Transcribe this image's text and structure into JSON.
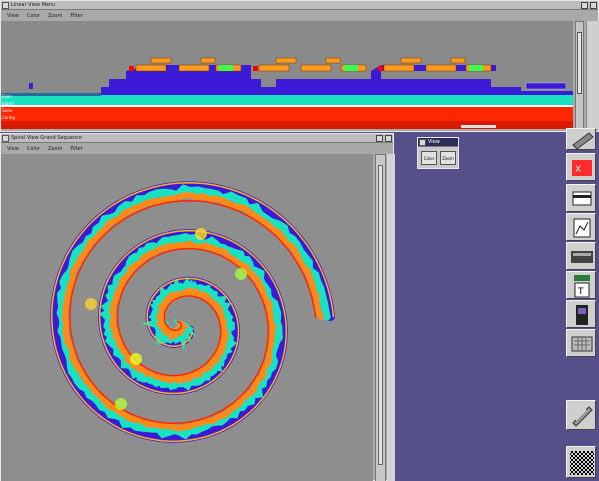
{
  "linear_window": {
    "title": "Linear View Menu",
    "menu": [
      "View",
      "Color",
      "Zoom",
      "Filter"
    ],
    "track_labels": [
      "Exon",
      "Intron",
      "Gene",
      "Contig"
    ]
  },
  "spiral_window": {
    "title": "Spiral View Grand Sequence",
    "menu": [
      "View",
      "Color",
      "Zoom",
      "Filter"
    ]
  },
  "view_palette": {
    "title": "View",
    "buttons": [
      "Color",
      "Zoom"
    ]
  },
  "toolbar": {
    "tools": [
      "pointer-tool-icon",
      "gene-tool-icon",
      "card-tool-icon",
      "chart-tool-icon",
      "scanner-tool-icon",
      "film-tool-icon",
      "calculator-tool-icon",
      "phone-tool-icon",
      "keyboard-tool-icon",
      "pencil-tool-icon",
      "pattern-tool-icon"
    ]
  },
  "colors": {
    "desktop": "#55508a",
    "red_band": "#ff2600",
    "cyan_band": "#18e2c0",
    "blue_band": "#3b1bd8",
    "orange": "#ff8a1a"
  }
}
